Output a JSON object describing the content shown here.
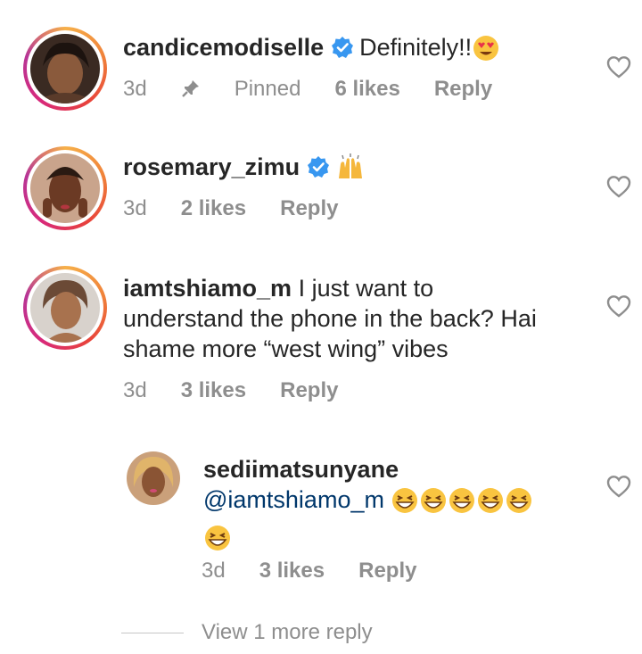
{
  "comments": [
    {
      "username": "candicemodiselle",
      "verified": true,
      "text": "Definitely!!",
      "text_emoji": "smiling-face-with-heart-eyes",
      "time": "3d",
      "pinned_label": "Pinned",
      "likes": "6 likes",
      "reply_label": "Reply"
    },
    {
      "username": "rosemary_zimu",
      "verified": true,
      "text": "",
      "text_emoji": "raising-hands",
      "time": "3d",
      "likes": "2 likes",
      "reply_label": "Reply"
    },
    {
      "username": "iamtshiamo_m",
      "verified": false,
      "text_line1": "I just want to",
      "text_line2": "understand the phone in the back? Hai",
      "text_line3": "shame more “west wing” vibes",
      "time": "3d",
      "likes": "3 likes",
      "reply_label": "Reply"
    },
    {
      "username": "sediimatsunyane",
      "verified": false,
      "mention": "@iamtshiamo_m",
      "text_emoji": "grinning-squinting-face x6",
      "time": "3d",
      "likes": "3 likes",
      "reply_label": "Reply"
    }
  ],
  "view_more_label": "View 1 more reply",
  "colors": {
    "verified_blue": "#3897f0",
    "meta_gray": "#8e8e8e",
    "mention_blue": "#00376b",
    "text": "#262626"
  }
}
